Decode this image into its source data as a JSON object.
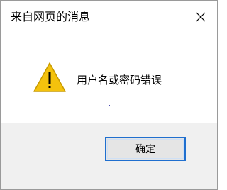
{
  "dialog": {
    "title": "来自网页的消息",
    "message": "用户名或密码错误",
    "ok_label": "确定",
    "icon": "warning-icon",
    "close_icon": "close-icon"
  },
  "colors": {
    "warning_fill": "#f4c20d",
    "warning_stroke": "#c79a00",
    "button_border": "#1f6fcf",
    "footer_bg": "#f0f0f0"
  }
}
